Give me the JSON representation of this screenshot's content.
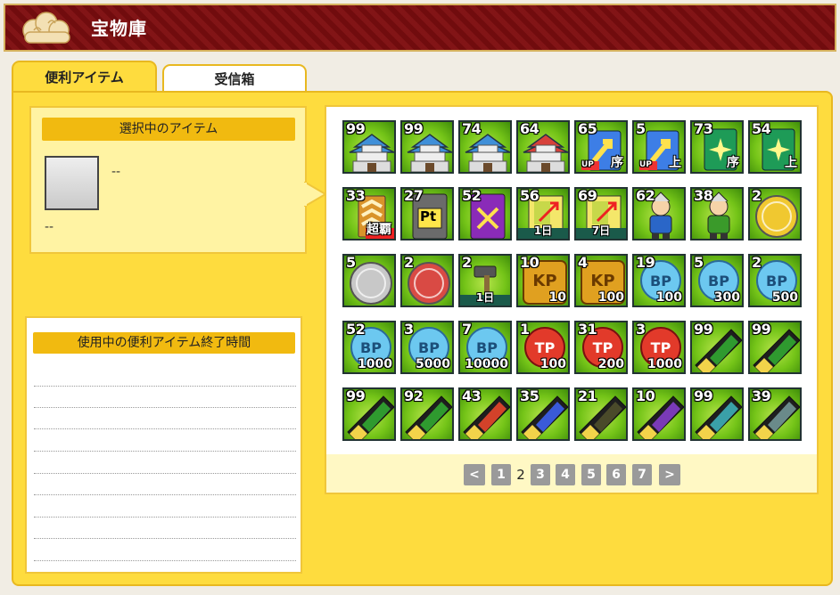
{
  "header": {
    "title": "宝物庫"
  },
  "tabs": [
    {
      "label": "便利アイテム"
    },
    {
      "label": "受信箱"
    }
  ],
  "selection": {
    "label": "選択中のアイテム",
    "name": "--",
    "description": "--"
  },
  "used_items": {
    "label": "使用中の便利アイテム終了時間"
  },
  "items": [
    {
      "qty": "99",
      "icon": "castle-blue-icon"
    },
    {
      "qty": "99",
      "icon": "castle-blue-icon"
    },
    {
      "qty": "74",
      "icon": "castle-blue-icon"
    },
    {
      "qty": "64",
      "icon": "castle-red-icon"
    },
    {
      "qty": "65",
      "icon": "up-arrow-card-icon",
      "tag": "序",
      "sub": "UP"
    },
    {
      "qty": "5",
      "icon": "up-arrow-card-icon",
      "tag": "上",
      "sub": "UP"
    },
    {
      "qty": "73",
      "icon": "sparkle-card-icon",
      "tag": "序"
    },
    {
      "qty": "54",
      "icon": "sparkle-card-icon",
      "tag": "上"
    },
    {
      "qty": "33",
      "icon": "rank-badge-icon",
      "tag": "超覇"
    },
    {
      "qty": "27",
      "icon": "pt-card-icon",
      "text": "Pt"
    },
    {
      "qty": "52",
      "icon": "swords-card-icon"
    },
    {
      "qty": "56",
      "icon": "boost-card-icon",
      "bar": "1日"
    },
    {
      "qty": "69",
      "icon": "boost-card-icon",
      "bar": "7日"
    },
    {
      "qty": "62",
      "icon": "soldier-blue-icon"
    },
    {
      "qty": "38",
      "icon": "soldier-green-icon"
    },
    {
      "qty": "2",
      "icon": "gold-coin-icon"
    },
    {
      "qty": "5",
      "icon": "silver-coin-icon"
    },
    {
      "qty": "2",
      "icon": "sp-coin-icon"
    },
    {
      "qty": "2",
      "icon": "hammer-icon",
      "bar": "1日"
    },
    {
      "qty": "10",
      "icon": "kp-card-icon",
      "val": "10"
    },
    {
      "qty": "4",
      "icon": "kp-card-icon",
      "val": "100"
    },
    {
      "qty": "19",
      "icon": "bp-coin-icon",
      "val": "100"
    },
    {
      "qty": "5",
      "icon": "bp-coin-icon",
      "val": "300"
    },
    {
      "qty": "2",
      "icon": "bp-coin-icon",
      "val": "500"
    },
    {
      "qty": "52",
      "icon": "bp-coin-icon",
      "val": "1000"
    },
    {
      "qty": "3",
      "icon": "bp-coin-icon",
      "val": "5000"
    },
    {
      "qty": "7",
      "icon": "bp-coin-icon",
      "val": "10000"
    },
    {
      "qty": "1",
      "icon": "tp-coin-icon",
      "val": "100"
    },
    {
      "qty": "31",
      "icon": "tp-coin-icon",
      "val": "200"
    },
    {
      "qty": "3",
      "icon": "tp-coin-icon",
      "val": "1000"
    },
    {
      "qty": "99",
      "icon": "scroll-green-icon"
    },
    {
      "qty": "99",
      "icon": "scroll-green-icon"
    },
    {
      "qty": "99",
      "icon": "scroll-green-icon"
    },
    {
      "qty": "92",
      "icon": "scroll-green-icon"
    },
    {
      "qty": "43",
      "icon": "scroll-red-icon"
    },
    {
      "qty": "35",
      "icon": "scroll-blue-icon"
    },
    {
      "qty": "21",
      "icon": "scroll-dark-icon"
    },
    {
      "qty": "10",
      "icon": "scroll-purple-icon"
    },
    {
      "qty": "99",
      "icon": "scroll-teal-icon"
    },
    {
      "qty": "39",
      "icon": "scroll-grey-icon"
    }
  ],
  "pagination": {
    "prev": "<",
    "next": ">",
    "pages": [
      "1",
      "2",
      "3",
      "4",
      "5",
      "6",
      "7"
    ],
    "current": "2"
  }
}
